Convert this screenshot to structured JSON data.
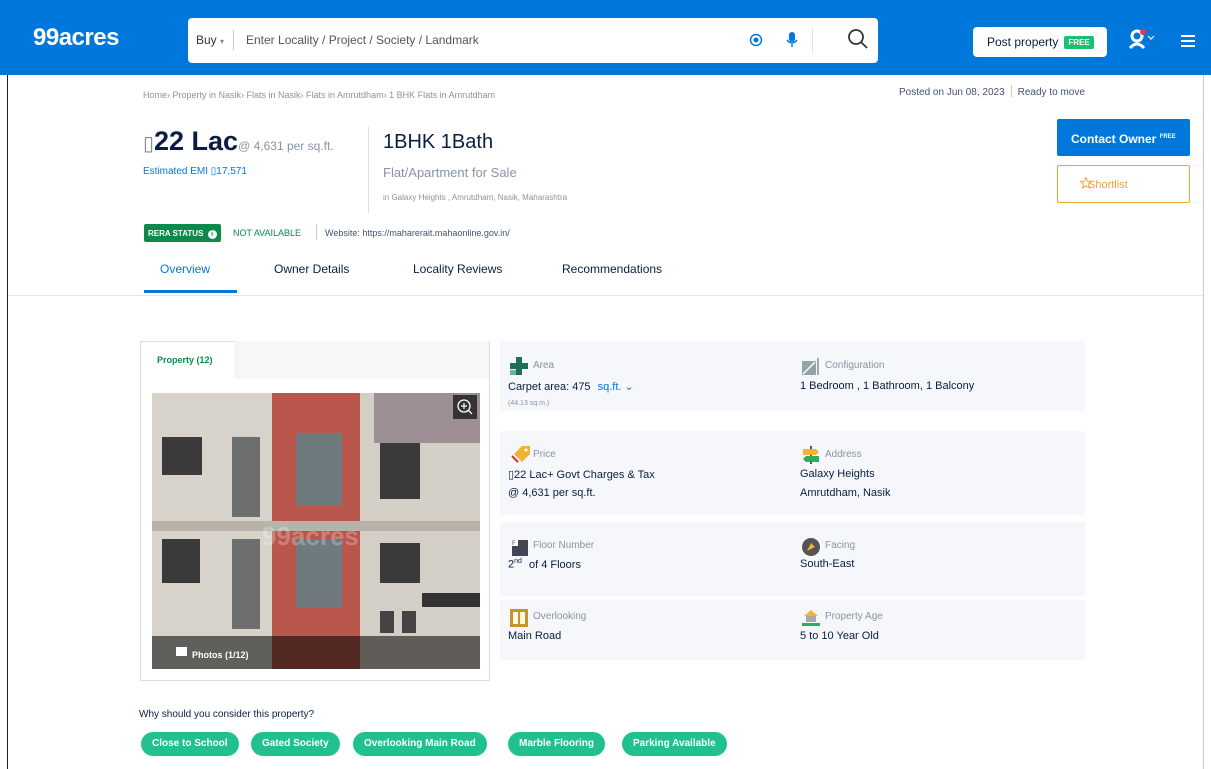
{
  "header": {
    "logo": "99acres",
    "search_type": "Buy",
    "search_placeholder": "Enter Locality / Project / Society / Landmark",
    "post_property_label": "Post property",
    "post_property_badge": "FREE",
    "accent_color": "#0078db"
  },
  "breadcrumb": "Home› Property in Nasik› Flats in Nasik› Flats in Amrutdham› 1 BHK Flats in Amrutdham",
  "posted": {
    "date": "Posted on Jun 08, 2023",
    "status": "Ready to move"
  },
  "listing": {
    "currency_symbol": "▯",
    "price": "22 Lac",
    "price_per_sqft": "@ 4,631 per sq.ft.",
    "emi": "Estimated EMI ▯17,571",
    "bhk": "1BHK 1Bath",
    "type": "Flat/Apartment for Sale",
    "location": "in Galaxy Heights , Amrutdham, Nasik, Maharashtra"
  },
  "actions": {
    "contact_label": "Contact Owner",
    "contact_badge": "FREE",
    "shortlist_label": "Shortlist"
  },
  "rera": {
    "label": "RERA STATUS",
    "status": "NOT AVAILABLE",
    "website": "Website: https://maharerait.mahaonline.gov.in/"
  },
  "tabs": [
    "Overview",
    "Owner Details",
    "Locality Reviews",
    "Recommendations"
  ],
  "gallery": {
    "tab_label": "Property (12)",
    "photos_label": "Photos (1/12)",
    "watermark": "99acres"
  },
  "details": {
    "area_label": "Area",
    "area_value": "Carpet area: 475",
    "area_unit": "sq.ft.",
    "area_sqm": "(44.13 sq.m.)",
    "config_label": "Configuration",
    "config_value": "1 Bedroom , 1 Bathroom, 1 Balcony",
    "price_label": "Price",
    "price_value": "▯22 Lac+ Govt Charges & Tax",
    "price_per": "@ 4,631 per sq.ft.",
    "address_label": "Address",
    "address_line1": "Galaxy Heights",
    "address_line2": "Amrutdham, Nasik",
    "floor_label": "Floor Number",
    "floor_value": "2",
    "floor_sup": "nd",
    "floor_of": "of 4 Floors",
    "facing_label": "Facing",
    "facing_value": "South-East",
    "overlooking_label": "Overlooking",
    "overlooking_value": "Main Road",
    "age_label": "Property Age",
    "age_value": "5 to 10 Year Old"
  },
  "why": {
    "heading": "Why should you consider this property?",
    "chips": [
      "Close to School",
      "Gated Society",
      "Overlooking Main Road",
      "Marble Flooring",
      "Parking Available"
    ]
  }
}
